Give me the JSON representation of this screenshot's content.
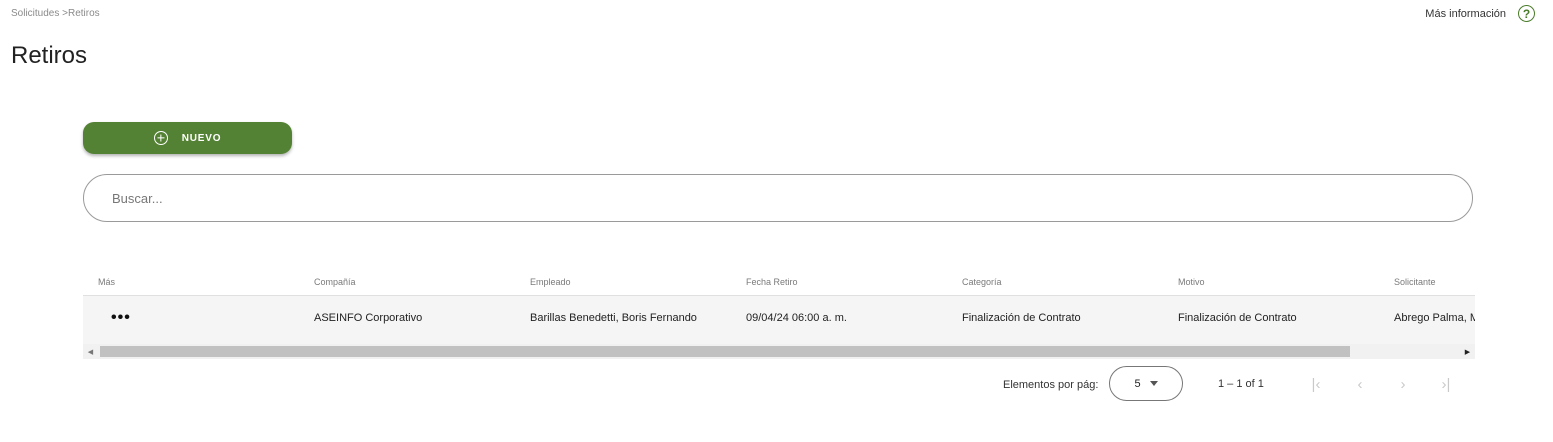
{
  "breadcrumb": "Solicitudes >Retiros",
  "help": {
    "label": "Más información",
    "icon": "question-icon",
    "symbol": "?"
  },
  "page": {
    "title": "Retiros"
  },
  "toolbar": {
    "new_label": "NUEVO",
    "new_icon": "add-circle-icon"
  },
  "search": {
    "placeholder": "Buscar...",
    "value": ""
  },
  "table": {
    "columns": [
      "Más",
      "Compañía",
      "Empleado",
      "Fecha Retiro",
      "Categoría",
      "Motivo",
      "Solicitante"
    ],
    "rows": [
      {
        "more": "•••",
        "compania": "ASEINFO Corporativo",
        "empleado": "Barillas Benedetti, Boris Fernando",
        "fecha_retiro": "09/04/24 06:00 a. m.",
        "categoria": "Finalización de Contrato",
        "motivo": "Finalización de Contrato",
        "solicitante": "Abrego Palma, M"
      }
    ]
  },
  "paginator": {
    "per_page_label": "Elementos por pág:",
    "per_page_value": "5",
    "range_label": "1 – 1 of 1",
    "first_symbol": "|‹",
    "prev_symbol": "‹",
    "next_symbol": "›",
    "last_symbol": "›|"
  },
  "colors": {
    "accent": "#548235",
    "help": "#4a7c2a"
  }
}
